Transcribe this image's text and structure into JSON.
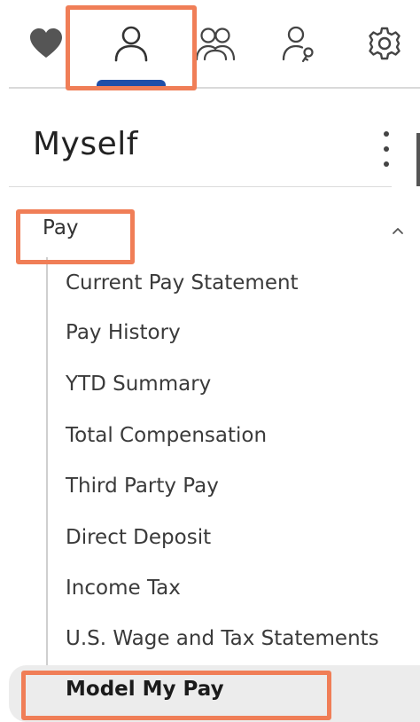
{
  "topbar": {
    "tabs": [
      {
        "name": "favorites",
        "icon": "heart-icon"
      },
      {
        "name": "myself",
        "icon": "person-icon",
        "active": true
      },
      {
        "name": "team",
        "icon": "people-icon"
      },
      {
        "name": "access",
        "icon": "person-key-icon"
      },
      {
        "name": "settings",
        "icon": "gear-icon"
      }
    ],
    "active_indicator_color": "#1f4fa8"
  },
  "header": {
    "title": "Myself",
    "menu_icon": "kebab-menu-icon"
  },
  "section": {
    "label": "Pay",
    "expanded": true,
    "chevron_icon": "chevron-up-icon",
    "items": [
      {
        "label": "Current Pay Statement"
      },
      {
        "label": "Pay History"
      },
      {
        "label": "YTD Summary"
      },
      {
        "label": "Total Compensation"
      },
      {
        "label": "Third Party Pay"
      },
      {
        "label": "Direct Deposit"
      },
      {
        "label": "Income Tax"
      },
      {
        "label": "U.S. Wage and Tax Statements"
      },
      {
        "label": "Model My Pay",
        "selected": true
      }
    ]
  },
  "colors": {
    "highlight": "#f07e57",
    "selected_row_bg": "#ececec"
  }
}
